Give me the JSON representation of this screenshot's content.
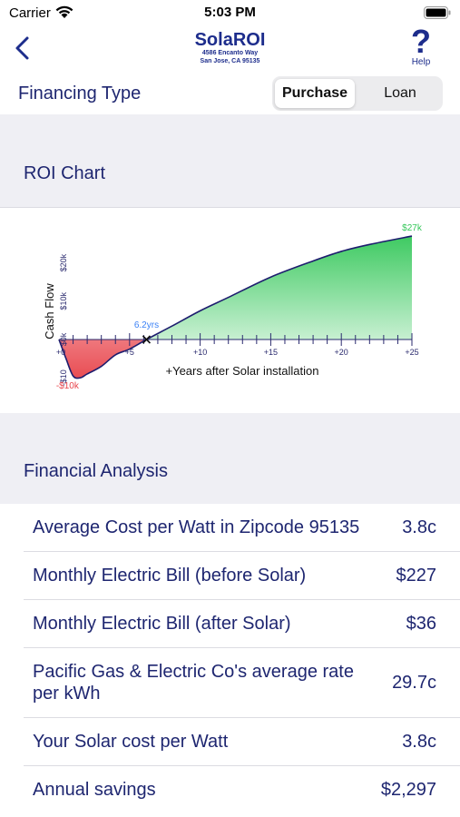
{
  "status_bar": {
    "carrier": "Carrier",
    "time": "5:03 PM"
  },
  "nav": {
    "title": "SolaROI",
    "address_line1": "4586 Encanto Way",
    "address_line2": "San Jose, CA 95135",
    "help_label": "Help",
    "help_glyph": "?"
  },
  "financing": {
    "label": "Financing Type",
    "options": [
      "Purchase",
      "Loan"
    ],
    "selected": "Purchase"
  },
  "roi_section": {
    "title": "ROI Chart"
  },
  "chart_data": {
    "type": "area",
    "xlabel": "+Years after Solar installation",
    "ylabel": "Cash Flow",
    "x_ticks": [
      "+0",
      "+5",
      "+10",
      "+15",
      "+20",
      "+25"
    ],
    "y_ticks": [
      "-$10",
      "$0k",
      "$10k",
      "$20k"
    ],
    "x": [
      0,
      0.5,
      1,
      1.5,
      2,
      3,
      4,
      5,
      6.2,
      8,
      10,
      12,
      15,
      18,
      20,
      22,
      25
    ],
    "y": [
      0,
      -5,
      -9.5,
      -10,
      -9,
      -7,
      -4,
      -2.5,
      0,
      3.5,
      7.5,
      11,
      16.3,
      20.5,
      23,
      24.8,
      27
    ],
    "xlim": [
      0,
      25
    ],
    "ylim": [
      -10,
      27
    ],
    "annotations": {
      "min_label": "-$10k",
      "max_label": "$27k",
      "breakeven_label": "6.2yrs",
      "breakeven_x": 6.2
    },
    "colors": {
      "positive": "#34c759",
      "negative": "#e8434a",
      "line": "#1d1d6e",
      "breakeven": "#3b82f6"
    }
  },
  "analysis_section": {
    "title": "Financial Analysis",
    "rows": [
      {
        "label": "Average Cost per Watt in Zipcode 95135",
        "value": "3.8c"
      },
      {
        "label": "Monthly Electric Bill (before Solar)",
        "value": "$227"
      },
      {
        "label": "Monthly Electric Bill (after Solar)",
        "value": "$36"
      },
      {
        "label_line1": "Pacific Gas & Electric Co's average rate",
        "label_line2": "per kWh",
        "value": "29.7c"
      },
      {
        "label": "Your Solar cost per Watt",
        "value": "3.8c"
      },
      {
        "label": "Annual savings",
        "value": "$2,297"
      }
    ]
  }
}
